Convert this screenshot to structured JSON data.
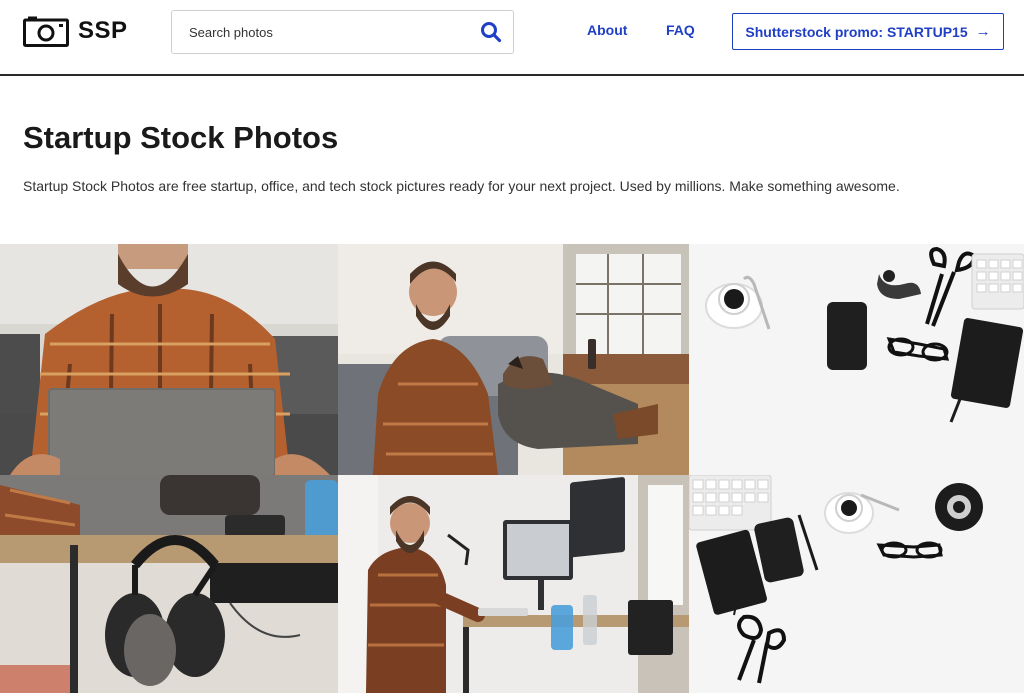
{
  "header": {
    "logo_text": "SSP",
    "search": {
      "placeholder": "Search photos",
      "value": ""
    },
    "nav": {
      "about": "About",
      "faq": "FAQ"
    },
    "promo": {
      "label": "Shutterstock promo: STARTUP15",
      "arrow": "→"
    }
  },
  "hero": {
    "title": "Startup Stock Photos",
    "tagline": "Startup Stock Photos are free startup, office, and tech stock pictures ready for your next project. Used by millions. Make something awesome."
  },
  "colors": {
    "accent": "#1f3fc6",
    "text": "#1a1a1a",
    "header_border": "#2a2a2a"
  },
  "icons": {
    "logo": "camera-icon",
    "search": "search-icon",
    "promo_arrow": "arrow-right-icon"
  }
}
